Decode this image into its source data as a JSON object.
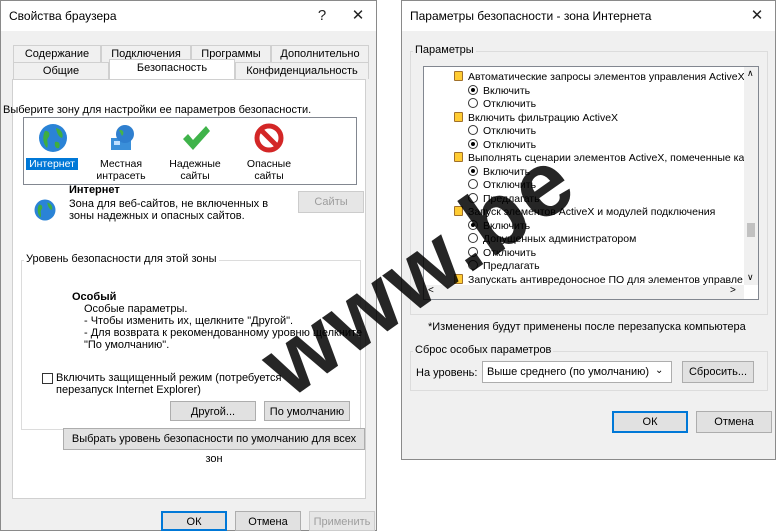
{
  "browser_props": {
    "title": "Свойства браузера",
    "help_glyph": "?",
    "close_glyph": "✕",
    "tabs_row1": [
      "Содержание",
      "Подключения",
      "Программы",
      "Дополнительно"
    ],
    "tabs_row2": [
      "Общие",
      "Безопасность",
      "Конфиденциальность"
    ],
    "zone_prompt": "Выберите зону для настройки ее параметров безопасности.",
    "zones": [
      {
        "label": "Интернет",
        "icon": "globe-icon"
      },
      {
        "label": "Местная интрасеть",
        "icon": "intranet-icon"
      },
      {
        "label": "Надежные сайты",
        "icon": "checkmark-icon"
      },
      {
        "label": "Опасные сайты",
        "icon": "restricted-icon"
      }
    ],
    "zone_title": "Интернет",
    "zone_desc": "Зона для веб-сайтов, не включенных в зоны надежных и опасных сайтов.",
    "sites_button": "Сайты",
    "security_group_label": "Уровень безопасности для этой зоны",
    "level_title": "Особый",
    "level_lines": [
      "Особые параметры.",
      "- Чтобы изменить их, щелкните \"Другой\".",
      "- Для возврата к рекомендованному уровню щелкните",
      "\"По умолчанию\"."
    ],
    "protected_mode": "Включить защищенный режим (потребуется перезапуск Internet Explorer)",
    "custom_button": "Другой...",
    "default_button": "По умолчанию",
    "all_zones_button": "Выбрать уровень безопасности по умолчанию для всех зон",
    "ok": "ОК",
    "cancel": "Отмена",
    "apply": "Применить"
  },
  "security_settings": {
    "title": "Параметры безопасности - зона Интернета",
    "close_glyph": "✕",
    "settings_label": "Параметры",
    "items": [
      {
        "type": "header",
        "text": "Автоматические запросы элементов управления ActiveX"
      },
      {
        "type": "radio",
        "text": "Включить",
        "checked": true
      },
      {
        "type": "radio",
        "text": "Отключить",
        "checked": false
      },
      {
        "type": "header",
        "text": "Включить фильтрацию ActiveX"
      },
      {
        "type": "radio",
        "text": "Отключить",
        "checked": false
      },
      {
        "type": "radio",
        "text": "Отключить",
        "checked": true
      },
      {
        "type": "header",
        "text": "Выполнять сценарии элементов ActiveX, помеченные как"
      },
      {
        "type": "radio",
        "text": "Включить",
        "checked": true
      },
      {
        "type": "radio",
        "text": "Отключить",
        "checked": false
      },
      {
        "type": "radio",
        "text": "Предлагать",
        "checked": false
      },
      {
        "type": "header",
        "text": "Запуск элементов ActiveX и модулей подключения"
      },
      {
        "type": "radio",
        "text": "Включить",
        "checked": true
      },
      {
        "type": "radio",
        "text": "Допущенных администратором",
        "checked": false
      },
      {
        "type": "radio",
        "text": "Отключить",
        "checked": false
      },
      {
        "type": "radio",
        "text": "Предлагать",
        "checked": false
      },
      {
        "type": "header",
        "text": "Запускать антивредоносное ПО для элементов управле"
      }
    ],
    "scroll_up": "∧",
    "scroll_down": "∨",
    "scroll_left": "<",
    "scroll_right": ">",
    "restart_note": "*Изменения будут применены после перезапуска компьютера",
    "reset_group_label": "Сброс особых параметров",
    "reset_to_label": "На уровень:",
    "reset_level_value": "Выше среднего (по умолчанию)",
    "reset_button": "Сбросить...",
    "ok": "ОК",
    "cancel": "Отмена"
  },
  "watermark": "www.be"
}
